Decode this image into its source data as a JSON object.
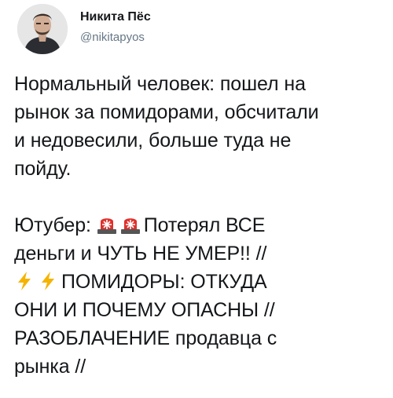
{
  "tweet": {
    "author": {
      "display_name": "Никита Пёс",
      "handle": "@nikitapyos",
      "avatar_icon": "profile-photo"
    },
    "paragraph1": [
      "Нормальный человек: пошел на",
      "рынок за помидорами, обсчитали",
      "и недовесили, больше туда не",
      "пойду."
    ],
    "paragraph2": {
      "line1_prefix": "Ютубер:",
      "line1_suffix": "Потерял ВСЕ",
      "line2": "деньги и ЧУТЬ НЕ УМЕР!! //",
      "line3_suffix": "ПОМИДОРЫ: ОТКУДА",
      "line4": "ОНИ И ПОЧЕМУ ОПАСНЫ //",
      "line5": "РАЗОБЛАЧЕНИЕ продавца с",
      "line6": "рынка //"
    },
    "emoji": {
      "siren": "police-car-light-icon",
      "lightning": "high-voltage-icon"
    },
    "colors": {
      "text": "#14171a",
      "handle": "#657786",
      "siren_red": "#e0302b",
      "lightning_yellow": "#f5b400"
    }
  }
}
